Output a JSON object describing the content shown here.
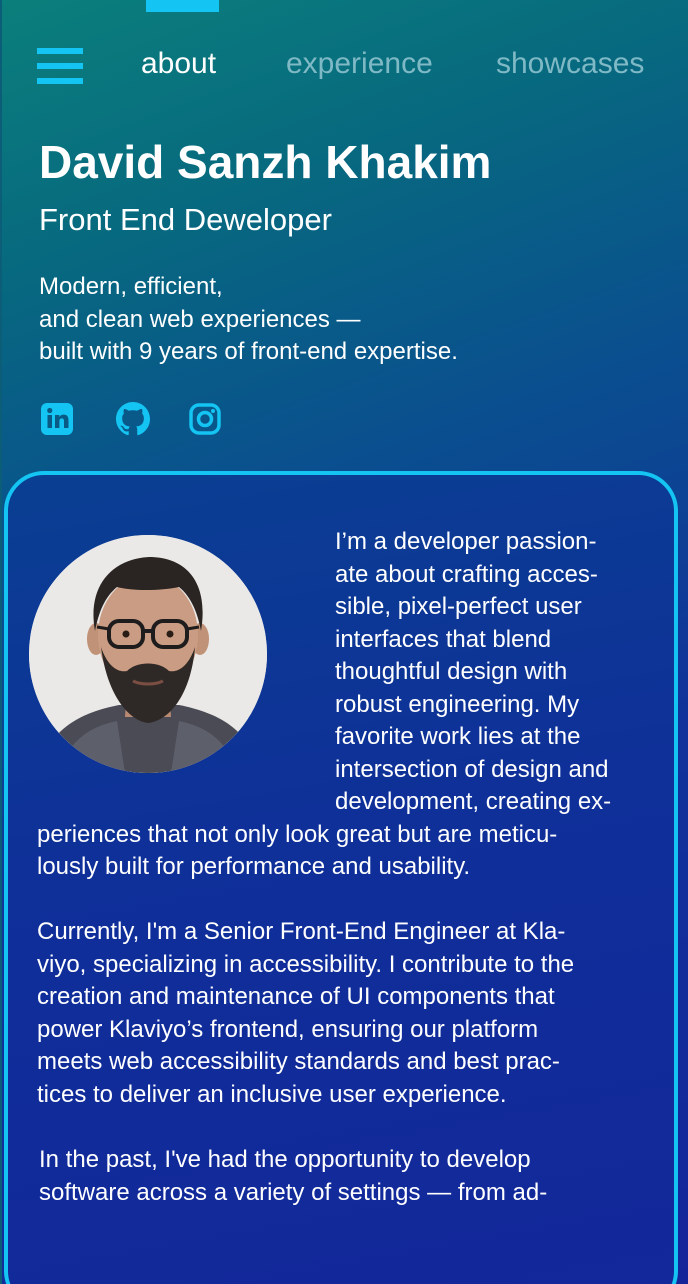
{
  "nav": {
    "menu_icon": "hamburger-menu-icon",
    "items": [
      {
        "label": "about",
        "active": true
      },
      {
        "label": "experience",
        "active": false
      },
      {
        "label": "showcases",
        "active": false
      }
    ]
  },
  "hero": {
    "name": "David Sanzh Khakim",
    "role": "Front End Deweloper",
    "tagline_lines": [
      "Modern, efficient,",
      "and clean web experiences —",
      "built with 9 years of front-end expertise."
    ]
  },
  "social": [
    {
      "icon": "linkedin-icon"
    },
    {
      "icon": "github-icon"
    },
    {
      "icon": "instagram-icon"
    }
  ],
  "about": {
    "lines": [
      "I’m a developer passion-",
      "ate about crafting acces-",
      "sible, pixel-perfect user",
      "interfaces that blend",
      "thoughtful design with",
      "robust engineering. My",
      "favorite work lies at the",
      "intersection of design and",
      "development, creating ex-",
      "periences that not only look great but are meticu-",
      "lously built for performance and usability.",
      "Currently, I'm a Senior Front-End Engineer at Kla-",
      "viyo, specializing in accessibility. I contribute to the",
      "creation and maintenance of UI components that",
      "power Klaviyo’s frontend, ensuring our platform",
      "meets web accessibility standards and best prac-",
      "tices to deliver an inclusive user experience.",
      "In the past, I've had the opportunity to develop",
      "software across a variety of settings — from ad-"
    ]
  },
  "colors": {
    "accent": "#14c4f2",
    "nav_inactive": "#7fb9c6",
    "text": "#ffffff",
    "card_border": "#14c4f2"
  }
}
